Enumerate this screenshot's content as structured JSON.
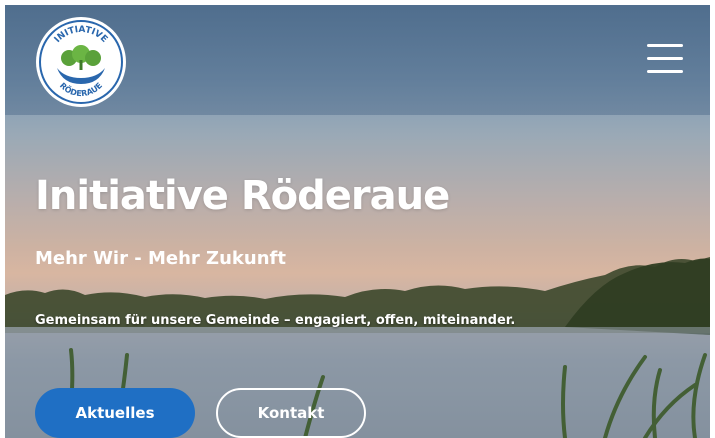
{
  "header": {
    "logo": {
      "top_text": "INITIATIVE",
      "bottom_text": "RÖDERAUE",
      "icon": "trees-in-hands-logo"
    },
    "menu_icon": "hamburger-menu-icon"
  },
  "hero": {
    "title": "Initiative Röderaue",
    "subtitle": "Mehr Wir - Mehr Zukunft",
    "text": "Gemeinsam für unsere Gemeinde – engagiert, offen, miteinander."
  },
  "buttons": {
    "primary_label": "Aktuelles",
    "secondary_label": "Kontakt"
  },
  "colors": {
    "primary_button": "#1f6fc4",
    "logo_green": "#5aa13a",
    "logo_blue": "#2a67ad"
  }
}
